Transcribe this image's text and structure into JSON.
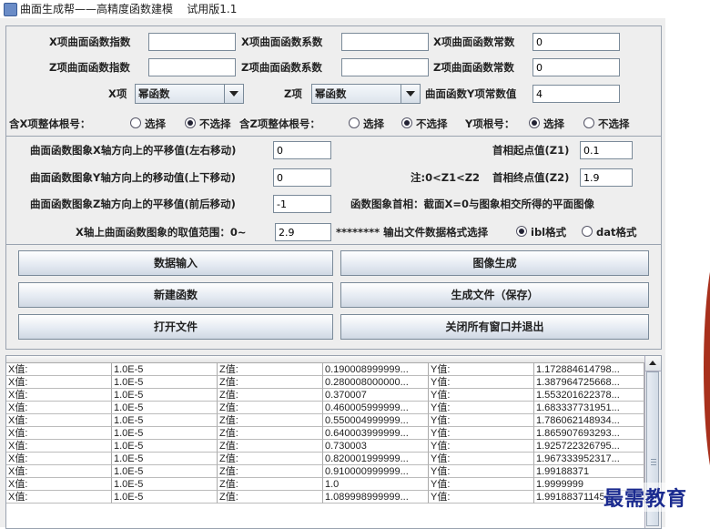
{
  "window": {
    "title": "曲面生成帮——高精度函数建模    试用版1.1"
  },
  "row1": {
    "x_exponent_label": "X项曲面函数指数",
    "x_exponent_value": "",
    "x_coef_label": "X项曲面函数系数",
    "x_coef_value": "",
    "x_const_label": "X项曲面函数常数",
    "x_const_value": "0"
  },
  "row2": {
    "z_exponent_label": "Z项曲面函数指数",
    "z_exponent_value": "",
    "z_coef_label": "Z项曲面函数系数",
    "z_coef_value": "",
    "z_const_label": "Z项曲面函数常数",
    "z_const_value": "0"
  },
  "row3": {
    "x_type_label": "X项",
    "x_type_value": "幂函数",
    "z_type_label": "Z项",
    "z_type_value": "幂函数",
    "y_const_label": "曲面函数Y项常数值",
    "y_const_value": "4"
  },
  "row4": {
    "x_root_label": "含X项整体根号：",
    "x_root_opt1": "选择",
    "x_root_opt2": "不选择",
    "z_root_label": "含Z项整体根号：",
    "z_root_opt1": "选择",
    "z_root_opt2": "不选择",
    "y_root_label": "Y项根号：",
    "y_root_opt1": "选择",
    "y_root_opt2": "不选择"
  },
  "params": {
    "x_shift_label": "曲面函数图象X轴方向上的平移值(左右移动)",
    "x_shift_value": "0",
    "y_shift_label": "曲面函数图象Y轴方向上的移动值(上下移动)",
    "y_shift_value": "0",
    "z_shift_label": "曲面函数图象Z轴方向上的平移值(前后移动)",
    "z_shift_value": "-1",
    "x_range_label": "X轴上曲面函数图象的取值范围：0~",
    "x_range_value": "2.9",
    "z1_label": "首相起点值(Z1)",
    "z1_value": "0.1",
    "note": "注:0<Z1<Z2",
    "z2_label": "首相终点值(Z2)",
    "z2_value": "1.9",
    "desc": "函数图象首相：截面X=0与图象相交所得的平面图像",
    "format_label": "******** 输出文件数据格式选择",
    "format_opt1": "ibl格式",
    "format_opt2": "dat格式"
  },
  "buttons": {
    "data_input": "数据输入",
    "generate_image": "图像生成",
    "new_function": "新建函数",
    "save_file": "生成文件（保存）",
    "open_file": "打开文件",
    "close_all": "关闭所有窗口并退出"
  },
  "table": {
    "rows": [
      [
        "X值:",
        "1.0E-5",
        "Z值:",
        "0.190008999999...",
        "Y值:",
        "1.172884614798..."
      ],
      [
        "X值:",
        "1.0E-5",
        "Z值:",
        "0.280008000000...",
        "Y值:",
        "1.387964725668..."
      ],
      [
        "X值:",
        "1.0E-5",
        "Z值:",
        "0.370007",
        "Y值:",
        "1.553201622378..."
      ],
      [
        "X值:",
        "1.0E-5",
        "Z值:",
        "0.460005999999...",
        "Y值:",
        "1.683337731951..."
      ],
      [
        "X值:",
        "1.0E-5",
        "Z值:",
        "0.550004999999...",
        "Y值:",
        "1.786062148934..."
      ],
      [
        "X值:",
        "1.0E-5",
        "Z值:",
        "0.640003999999...",
        "Y值:",
        "1.865907693293..."
      ],
      [
        "X值:",
        "1.0E-5",
        "Z值:",
        "0.730003",
        "Y值:",
        "1.925722326795..."
      ],
      [
        "X值:",
        "1.0E-5",
        "Z值:",
        "0.820001999999...",
        "Y值:",
        "1.967333952317..."
      ],
      [
        "X值:",
        "1.0E-5",
        "Z值:",
        "0.910000999999...",
        "Y值:",
        "1.99188371"
      ],
      [
        "X值:",
        "1.0E-5",
        "Z值:",
        "1.0",
        "Y值:",
        "1.9999999"
      ],
      [
        "X值:",
        "1.0E-5",
        "Z值:",
        "1.089998999999...",
        "Y值:",
        "1.991883711453..."
      ]
    ]
  },
  "watermark": "最需教育"
}
